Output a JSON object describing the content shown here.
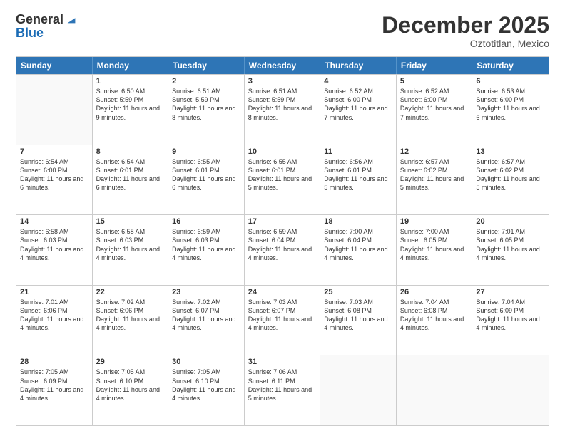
{
  "logo": {
    "general": "General",
    "blue": "Blue"
  },
  "title": "December 2025",
  "subtitle": "Oztotitlan, Mexico",
  "days": [
    "Sunday",
    "Monday",
    "Tuesday",
    "Wednesday",
    "Thursday",
    "Friday",
    "Saturday"
  ],
  "weeks": [
    [
      {
        "day": "",
        "empty": true
      },
      {
        "day": "1",
        "sunrise": "6:50 AM",
        "sunset": "5:59 PM",
        "daylight": "11 hours and 9 minutes."
      },
      {
        "day": "2",
        "sunrise": "6:51 AM",
        "sunset": "5:59 PM",
        "daylight": "11 hours and 8 minutes."
      },
      {
        "day": "3",
        "sunrise": "6:51 AM",
        "sunset": "5:59 PM",
        "daylight": "11 hours and 8 minutes."
      },
      {
        "day": "4",
        "sunrise": "6:52 AM",
        "sunset": "6:00 PM",
        "daylight": "11 hours and 7 minutes."
      },
      {
        "day": "5",
        "sunrise": "6:52 AM",
        "sunset": "6:00 PM",
        "daylight": "11 hours and 7 minutes."
      },
      {
        "day": "6",
        "sunrise": "6:53 AM",
        "sunset": "6:00 PM",
        "daylight": "11 hours and 6 minutes."
      }
    ],
    [
      {
        "day": "7",
        "sunrise": "6:54 AM",
        "sunset": "6:00 PM",
        "daylight": "11 hours and 6 minutes."
      },
      {
        "day": "8",
        "sunrise": "6:54 AM",
        "sunset": "6:01 PM",
        "daylight": "11 hours and 6 minutes."
      },
      {
        "day": "9",
        "sunrise": "6:55 AM",
        "sunset": "6:01 PM",
        "daylight": "11 hours and 6 minutes."
      },
      {
        "day": "10",
        "sunrise": "6:55 AM",
        "sunset": "6:01 PM",
        "daylight": "11 hours and 5 minutes."
      },
      {
        "day": "11",
        "sunrise": "6:56 AM",
        "sunset": "6:01 PM",
        "daylight": "11 hours and 5 minutes."
      },
      {
        "day": "12",
        "sunrise": "6:57 AM",
        "sunset": "6:02 PM",
        "daylight": "11 hours and 5 minutes."
      },
      {
        "day": "13",
        "sunrise": "6:57 AM",
        "sunset": "6:02 PM",
        "daylight": "11 hours and 5 minutes."
      }
    ],
    [
      {
        "day": "14",
        "sunrise": "6:58 AM",
        "sunset": "6:03 PM",
        "daylight": "11 hours and 4 minutes."
      },
      {
        "day": "15",
        "sunrise": "6:58 AM",
        "sunset": "6:03 PM",
        "daylight": "11 hours and 4 minutes."
      },
      {
        "day": "16",
        "sunrise": "6:59 AM",
        "sunset": "6:03 PM",
        "daylight": "11 hours and 4 minutes."
      },
      {
        "day": "17",
        "sunrise": "6:59 AM",
        "sunset": "6:04 PM",
        "daylight": "11 hours and 4 minutes."
      },
      {
        "day": "18",
        "sunrise": "7:00 AM",
        "sunset": "6:04 PM",
        "daylight": "11 hours and 4 minutes."
      },
      {
        "day": "19",
        "sunrise": "7:00 AM",
        "sunset": "6:05 PM",
        "daylight": "11 hours and 4 minutes."
      },
      {
        "day": "20",
        "sunrise": "7:01 AM",
        "sunset": "6:05 PM",
        "daylight": "11 hours and 4 minutes."
      }
    ],
    [
      {
        "day": "21",
        "sunrise": "7:01 AM",
        "sunset": "6:06 PM",
        "daylight": "11 hours and 4 minutes."
      },
      {
        "day": "22",
        "sunrise": "7:02 AM",
        "sunset": "6:06 PM",
        "daylight": "11 hours and 4 minutes."
      },
      {
        "day": "23",
        "sunrise": "7:02 AM",
        "sunset": "6:07 PM",
        "daylight": "11 hours and 4 minutes."
      },
      {
        "day": "24",
        "sunrise": "7:03 AM",
        "sunset": "6:07 PM",
        "daylight": "11 hours and 4 minutes."
      },
      {
        "day": "25",
        "sunrise": "7:03 AM",
        "sunset": "6:08 PM",
        "daylight": "11 hours and 4 minutes."
      },
      {
        "day": "26",
        "sunrise": "7:04 AM",
        "sunset": "6:08 PM",
        "daylight": "11 hours and 4 minutes."
      },
      {
        "day": "27",
        "sunrise": "7:04 AM",
        "sunset": "6:09 PM",
        "daylight": "11 hours and 4 minutes."
      }
    ],
    [
      {
        "day": "28",
        "sunrise": "7:05 AM",
        "sunset": "6:09 PM",
        "daylight": "11 hours and 4 minutes."
      },
      {
        "day": "29",
        "sunrise": "7:05 AM",
        "sunset": "6:10 PM",
        "daylight": "11 hours and 4 minutes."
      },
      {
        "day": "30",
        "sunrise": "7:05 AM",
        "sunset": "6:10 PM",
        "daylight": "11 hours and 4 minutes."
      },
      {
        "day": "31",
        "sunrise": "7:06 AM",
        "sunset": "6:11 PM",
        "daylight": "11 hours and 5 minutes."
      },
      {
        "day": "",
        "empty": true
      },
      {
        "day": "",
        "empty": true
      },
      {
        "day": "",
        "empty": true
      }
    ]
  ]
}
